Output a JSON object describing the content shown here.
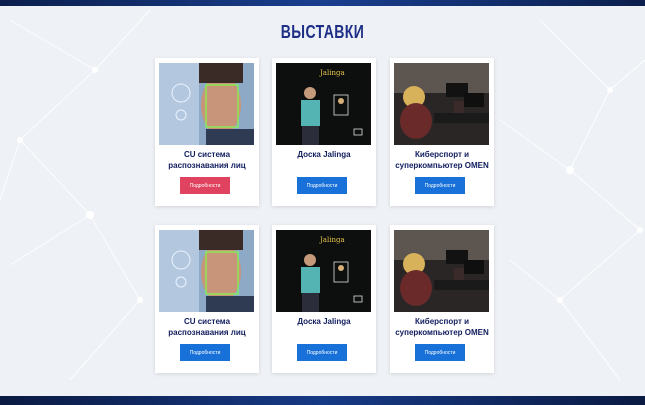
{
  "section_title": "ВЫСТАВКИ",
  "colors": {
    "button_primary": "#1771d9",
    "button_active": "#e0435f",
    "title": "#1d2f86"
  },
  "cards": [
    {
      "title": "CU система распознавания лиц",
      "button": "Подробности",
      "image": "face-recognition-image"
    },
    {
      "title": "Доска Jalinga",
      "button": "Подробности",
      "image": "jalinga-board-image"
    },
    {
      "title": "Киберспорт и суперкомпьютер OMEN",
      "button": "Подробности",
      "image": "esports-image"
    },
    {
      "title": "CU система распознавания лиц",
      "button": "Подробности",
      "image": "face-recognition-image"
    },
    {
      "title": "Доска Jalinga",
      "button": "Подробности",
      "image": "jalinga-board-image"
    },
    {
      "title": "Киберспорт и суперкомпьютер OMEN",
      "button": "Подробности",
      "image": "esports-image"
    }
  ]
}
